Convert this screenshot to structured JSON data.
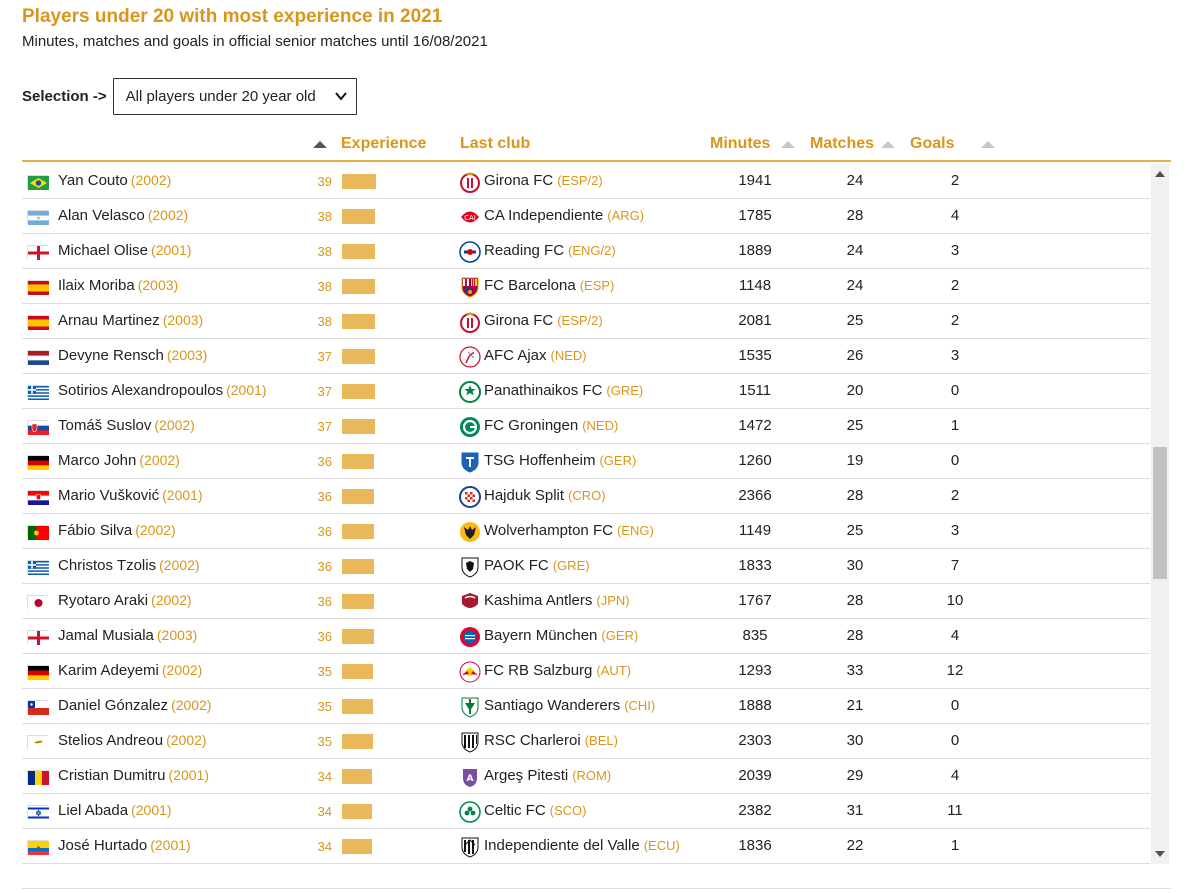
{
  "title": "Players under 20 with most experience in 2021",
  "subtitle": "Minutes, matches and goals in official senior matches until 16/08/2021",
  "selection": {
    "label": "Selection ->",
    "value": "All players under 20 year old"
  },
  "columns": {
    "experience": "Experience",
    "last_club": "Last club",
    "minutes": "Minutes",
    "matches": "Matches",
    "goals": "Goals"
  },
  "colors": {
    "accent": "#d9961a",
    "bar": "#e8b85a",
    "header_rule": "#e2b14a"
  },
  "players": [
    {
      "name": "Yan Couto",
      "year": "(2002)",
      "score": 39,
      "club": "Girona FC",
      "country": "(ESP/2)",
      "minutes": 1941,
      "matches": 24,
      "goals": 2,
      "flag": "brazil-flag",
      "crest": "girona-crest"
    },
    {
      "name": "Alan Velasco",
      "year": "(2002)",
      "score": 38,
      "club": "CA Independiente",
      "country": "(ARG)",
      "minutes": 1785,
      "matches": 28,
      "goals": 4,
      "flag": "argentina-flag",
      "crest": "independiente-crest"
    },
    {
      "name": "Michael Olise",
      "year": "(2001)",
      "score": 38,
      "club": "Reading FC",
      "country": "(ENG/2)",
      "minutes": 1889,
      "matches": 24,
      "goals": 3,
      "flag": "england-flag",
      "crest": "reading-crest"
    },
    {
      "name": "Ilaix Moriba",
      "year": "(2003)",
      "score": 38,
      "club": "FC Barcelona",
      "country": "(ESP)",
      "minutes": 1148,
      "matches": 24,
      "goals": 2,
      "flag": "spain-flag",
      "crest": "barcelona-crest"
    },
    {
      "name": "Arnau Martinez",
      "year": "(2003)",
      "score": 38,
      "club": "Girona FC",
      "country": "(ESP/2)",
      "minutes": 2081,
      "matches": 25,
      "goals": 2,
      "flag": "spain-flag",
      "crest": "girona-crest"
    },
    {
      "name": "Devyne Rensch",
      "year": "(2003)",
      "score": 37,
      "club": "AFC Ajax",
      "country": "(NED)",
      "minutes": 1535,
      "matches": 26,
      "goals": 3,
      "flag": "netherlands-flag",
      "crest": "ajax-crest"
    },
    {
      "name": "Sotirios Alexandropoulos",
      "year": "(2001)",
      "score": 37,
      "club": "Panathinaikos FC",
      "country": "(GRE)",
      "minutes": 1511,
      "matches": 20,
      "goals": 0,
      "flag": "greece-flag",
      "crest": "panathinaikos-crest"
    },
    {
      "name": "Tomáš Suslov",
      "year": "(2002)",
      "score": 37,
      "club": "FC Groningen",
      "country": "(NED)",
      "minutes": 1472,
      "matches": 25,
      "goals": 1,
      "flag": "slovakia-flag",
      "crest": "groningen-crest"
    },
    {
      "name": "Marco John",
      "year": "(2002)",
      "score": 36,
      "club": "TSG Hoffenheim",
      "country": "(GER)",
      "minutes": 1260,
      "matches": 19,
      "goals": 0,
      "flag": "germany-flag",
      "crest": "hoffenheim-crest"
    },
    {
      "name": "Mario Vušković",
      "year": "(2001)",
      "score": 36,
      "club": "Hajduk Split",
      "country": "(CRO)",
      "minutes": 2366,
      "matches": 28,
      "goals": 2,
      "flag": "croatia-flag",
      "crest": "hajduk-crest"
    },
    {
      "name": "Fábio Silva",
      "year": "(2002)",
      "score": 36,
      "club": "Wolverhampton FC",
      "country": "(ENG)",
      "minutes": 1149,
      "matches": 25,
      "goals": 3,
      "flag": "portugal-flag",
      "crest": "wolves-crest"
    },
    {
      "name": "Christos Tzolis",
      "year": "(2002)",
      "score": 36,
      "club": "PAOK FC",
      "country": "(GRE)",
      "minutes": 1833,
      "matches": 30,
      "goals": 7,
      "flag": "greece-flag",
      "crest": "paok-crest"
    },
    {
      "name": "Ryotaro Araki",
      "year": "(2002)",
      "score": 36,
      "club": "Kashima Antlers",
      "country": "(JPN)",
      "minutes": 1767,
      "matches": 28,
      "goals": 10,
      "flag": "japan-flag",
      "crest": "kashima-crest"
    },
    {
      "name": "Jamal Musiala",
      "year": "(2003)",
      "score": 36,
      "club": "Bayern München",
      "country": "(GER)",
      "minutes": 835,
      "matches": 28,
      "goals": 4,
      "flag": "england-flag",
      "crest": "bayern-crest"
    },
    {
      "name": "Karim Adeyemi",
      "year": "(2002)",
      "score": 35,
      "club": "FC RB Salzburg",
      "country": "(AUT)",
      "minutes": 1293,
      "matches": 33,
      "goals": 12,
      "flag": "germany-flag",
      "crest": "salzburg-crest"
    },
    {
      "name": "Daniel Gónzalez",
      "year": "(2002)",
      "score": 35,
      "club": "Santiago Wanderers",
      "country": "(CHI)",
      "minutes": 1888,
      "matches": 21,
      "goals": 0,
      "flag": "chile-flag",
      "crest": "wanderers-crest"
    },
    {
      "name": "Stelios Andreou",
      "year": "(2002)",
      "score": 35,
      "club": "RSC Charleroi",
      "country": "(BEL)",
      "minutes": 2303,
      "matches": 30,
      "goals": 0,
      "flag": "cyprus-flag",
      "crest": "charleroi-crest"
    },
    {
      "name": "Cristian Dumitru",
      "year": "(2001)",
      "score": 34,
      "club": "Argeş Pitesti",
      "country": "(ROM)",
      "minutes": 2039,
      "matches": 29,
      "goals": 4,
      "flag": "romania-flag",
      "crest": "arges-crest"
    },
    {
      "name": "Liel Abada",
      "year": "(2001)",
      "score": 34,
      "club": "Celtic FC",
      "country": "(SCO)",
      "minutes": 2382,
      "matches": 31,
      "goals": 11,
      "flag": "israel-flag",
      "crest": "celtic-crest"
    },
    {
      "name": "José Hurtado",
      "year": "(2001)",
      "score": 34,
      "club": "Independiente del Valle",
      "country": "(ECU)",
      "minutes": 1836,
      "matches": 22,
      "goals": 1,
      "flag": "ecuador-flag",
      "crest": "idv-crest"
    }
  ]
}
